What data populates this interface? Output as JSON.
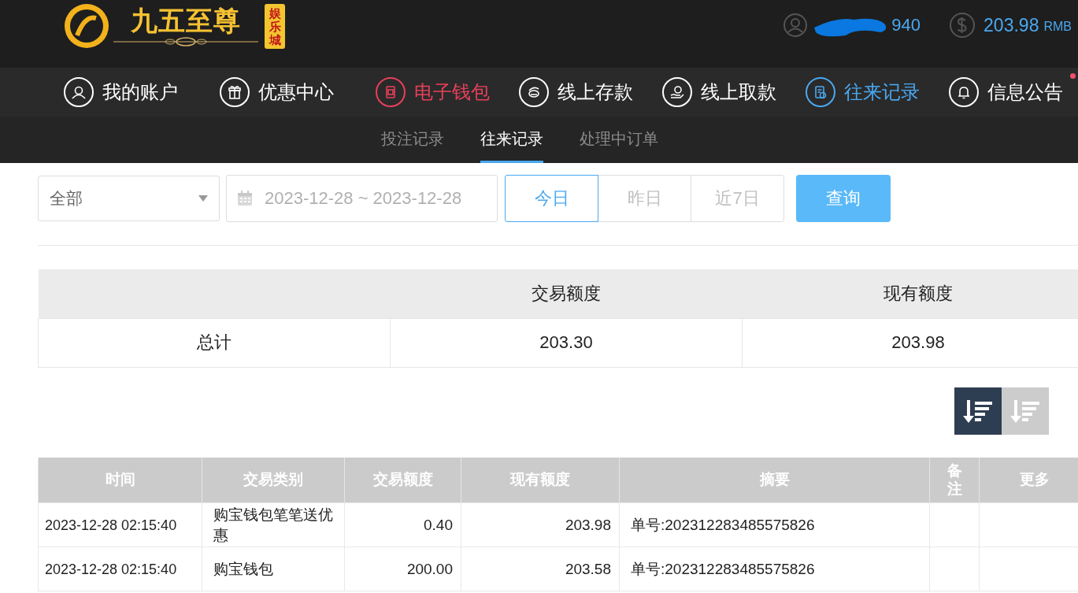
{
  "header": {
    "logo": {
      "name": "九五至尊",
      "badge": "娱乐城"
    },
    "user": {
      "name": "940"
    },
    "balance": {
      "amount": "203.98",
      "currency": "RMB"
    }
  },
  "nav": [
    {
      "label": "我的账户",
      "kind": "user",
      "color": "#ffffff",
      "dot": false
    },
    {
      "label": "优惠中心",
      "kind": "gift",
      "color": "#ffffff",
      "dot": false
    },
    {
      "label": "电子钱包",
      "kind": "wallet",
      "color": "#e8405a",
      "dot": false
    },
    {
      "label": "线上存款",
      "kind": "deposit",
      "color": "#ffffff",
      "dot": false
    },
    {
      "label": "线上取款",
      "kind": "withdraw",
      "color": "#ffffff",
      "dot": false
    },
    {
      "label": "往来记录",
      "kind": "record",
      "color": "#4aa8f0",
      "dot": false
    },
    {
      "label": "信息公告",
      "kind": "bell",
      "color": "#ffffff",
      "dot": true
    }
  ],
  "subtabs": [
    {
      "label": "投注记录",
      "selected": false
    },
    {
      "label": "往来记录",
      "selected": true
    },
    {
      "label": "处理中订单",
      "selected": false
    }
  ],
  "filters": {
    "type": {
      "value": "全部"
    },
    "date_range": {
      "value": "2023-12-28 ~ 2023-12-28"
    },
    "quick_ranges": [
      {
        "label": "今日",
        "selected": true
      },
      {
        "label": "昨日",
        "selected": false
      },
      {
        "label": "近7日",
        "selected": false
      }
    ],
    "query_button": "查询"
  },
  "summary": {
    "columns": [
      "交易额度",
      "现有额度"
    ],
    "rows": [
      {
        "label": "总计",
        "cells": [
          "203.30",
          "203.98"
        ]
      }
    ]
  },
  "sort_buttons": [
    {
      "selected": true
    },
    {
      "selected": false
    }
  ],
  "table": {
    "columns": [
      "时间",
      "交易类别",
      "交易额度",
      "现有额度",
      "摘要",
      "备注",
      "更多"
    ],
    "rows": [
      [
        "2023-12-28 02:15:40",
        "购宝钱包笔笔送优惠",
        "0.40",
        "203.98",
        "单号:202312283485575826",
        "",
        ""
      ],
      [
        "2023-12-28 02:15:40",
        "购宝钱包",
        "200.00",
        "203.58",
        "单号:202312283485575826",
        "",
        ""
      ]
    ]
  }
}
